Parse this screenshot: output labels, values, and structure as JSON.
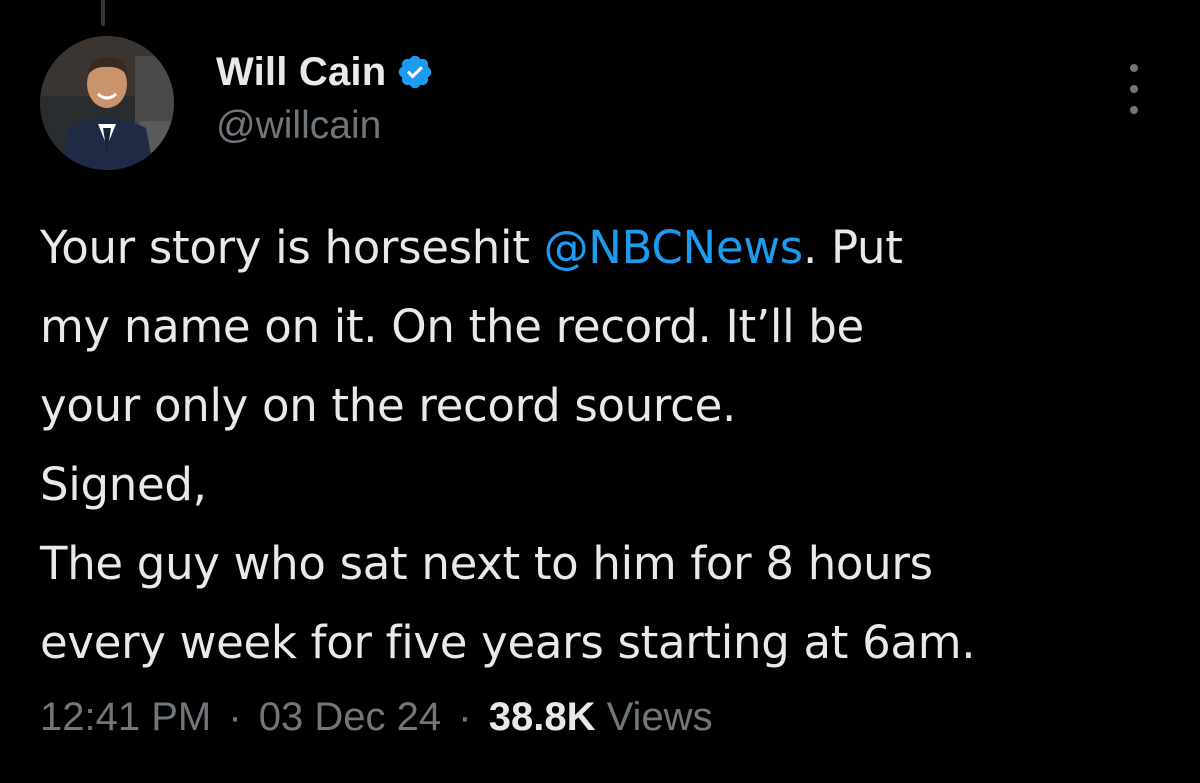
{
  "author": {
    "display_name": "Will Cain",
    "handle": "@willcain",
    "verified": true
  },
  "tweet": {
    "line1_prefix": "Your story is horseshit ",
    "line1_mention": "@NBCNews",
    "line1_suffix": ". Put",
    "line2": "my name on it. On the record. It’ll be",
    "line3": "your only on the record source.",
    "line4": "Signed,",
    "line5": "The guy who sat next to him for 8 hours",
    "line6": "every week for five years starting at 6am."
  },
  "meta": {
    "time": "12:41 PM",
    "separator": "·",
    "date": "03 Dec 24",
    "views_count": "38.8K",
    "views_label": "Views"
  },
  "icons": {
    "verified": "verified-badge-icon",
    "more": "more-options-icon"
  },
  "colors": {
    "background": "#000000",
    "text": "#e7e9ea",
    "secondary": "#71767b",
    "accent": "#1d9bf0"
  }
}
